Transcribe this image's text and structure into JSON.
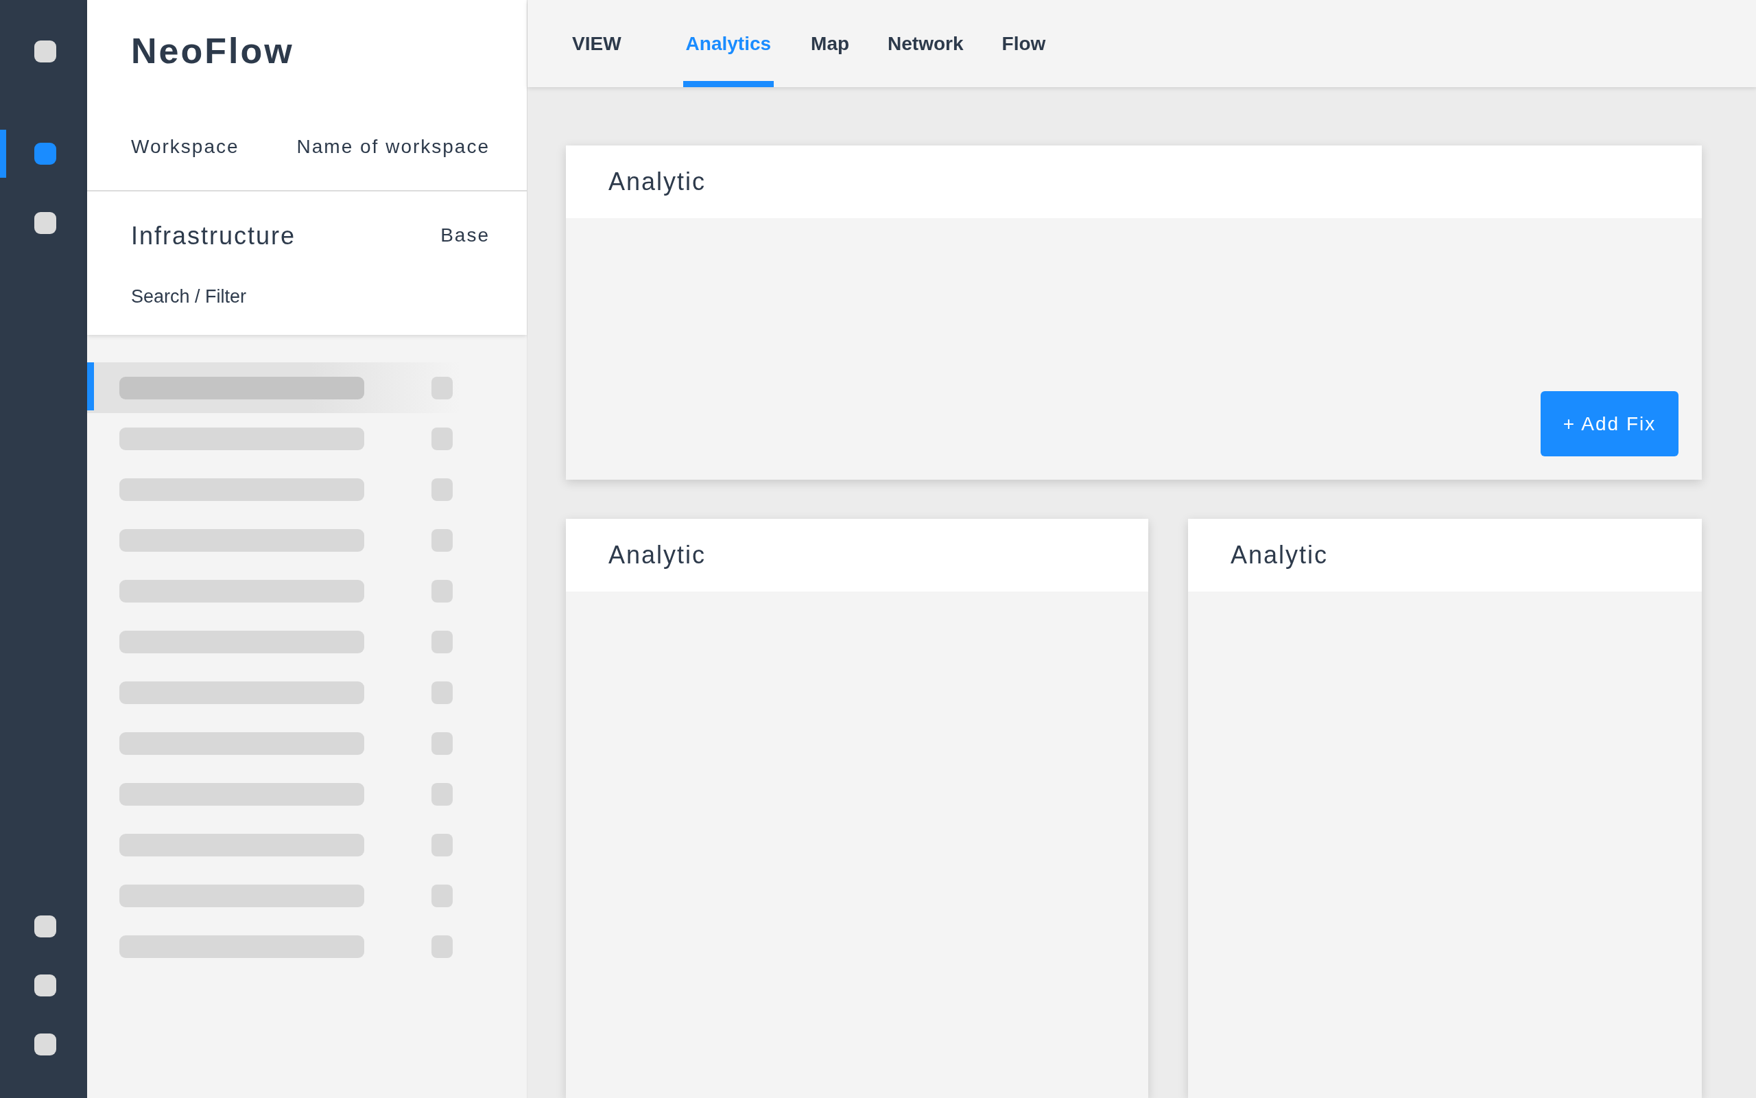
{
  "rail": {
    "top": [
      {
        "selected": false
      },
      {
        "selected": true
      },
      {
        "selected": false
      }
    ],
    "bottom": [
      {
        "selected": false
      },
      {
        "selected": false
      },
      {
        "selected": false
      }
    ]
  },
  "sidebar": {
    "brand": "NeoFlow",
    "workspace_label": "Workspace",
    "workspace_name": "Name of workspace",
    "section_title": "Infrastructure",
    "section_badge": "Base",
    "search": "Search / Filter",
    "items": [
      {
        "selected": true
      },
      {
        "selected": false
      },
      {
        "selected": false
      },
      {
        "selected": false
      },
      {
        "selected": false
      },
      {
        "selected": false
      },
      {
        "selected": false
      },
      {
        "selected": false
      },
      {
        "selected": false
      },
      {
        "selected": false
      },
      {
        "selected": false
      },
      {
        "selected": false
      }
    ]
  },
  "header": {
    "label": "VIEW",
    "tabs": [
      {
        "label": "Analytics",
        "selected": true
      },
      {
        "label": "Map",
        "selected": false
      },
      {
        "label": "Network",
        "selected": false
      },
      {
        "label": "Flow",
        "selected": false
      }
    ]
  },
  "cards": [
    {
      "title": "Analytic",
      "button": "+ Add Fix"
    },
    {
      "title": "Analytic"
    },
    {
      "title": "Analytic"
    }
  ]
}
